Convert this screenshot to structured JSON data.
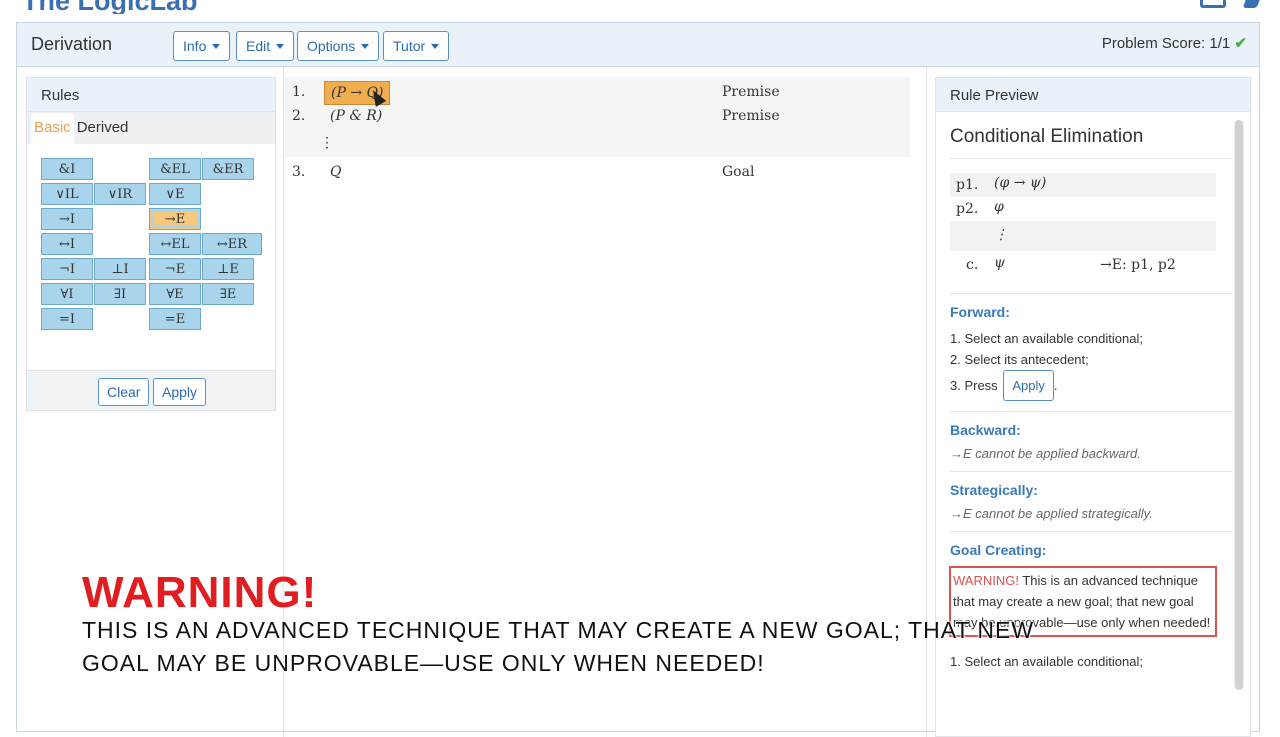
{
  "app": {
    "brand": "The LogicLab"
  },
  "header": {
    "title": "Derivation",
    "menus": [
      "Info",
      "Edit",
      "Options",
      "Tutor"
    ],
    "score_label": "Problem Score: 1/1",
    "score_check": "✔"
  },
  "rules_panel": {
    "title": "Rules",
    "tabs": [
      "Basic",
      "Derived"
    ],
    "buttons": [
      "&I",
      "&EL",
      "&ER",
      "∨IL",
      "∨IR",
      "∨E",
      "→I",
      "→E",
      "↔I",
      "↔EL",
      "↔ER",
      "¬I",
      "⊥I",
      "¬E",
      "⊥E",
      "∀I",
      "∃I",
      "∀E",
      "∃E",
      "=I",
      "=E"
    ],
    "selected": "→E",
    "clear_label": "Clear",
    "apply_label": "Apply"
  },
  "derivation": {
    "lines": [
      {
        "num": "1.",
        "formula": "(P → Q)",
        "just": "Premise",
        "highlighted": true
      },
      {
        "num": "2.",
        "formula": "(P & R)",
        "just": "Premise",
        "highlighted": false
      },
      {
        "num": "3.",
        "formula": "Q",
        "just": "Goal",
        "highlighted": false
      }
    ],
    "gap_dots": "⋮"
  },
  "rule_preview": {
    "title": "Rule Preview",
    "rule_name": "Conditional Elimination",
    "schema": [
      {
        "num": "p1.",
        "formula": "(φ → ψ)",
        "just": ""
      },
      {
        "num": "p2.",
        "formula": "φ",
        "just": ""
      },
      {
        "num": "",
        "formula": "⋮",
        "just": ""
      },
      {
        "num": "c.",
        "formula": "ψ",
        "just": "→E: p1, p2"
      }
    ],
    "forward": {
      "heading": "Forward:",
      "steps": [
        "1. Select an available conditional;",
        "2. Select its antecedent;",
        "3. Press"
      ],
      "apply_label": "Apply",
      "end": "."
    },
    "backward": {
      "heading": "Backward:",
      "text": "→E cannot be applied backward."
    },
    "strategically": {
      "heading": "Strategically:",
      "text": "→E cannot be applied strategically."
    },
    "goal_creating": {
      "heading": "Goal Creating:",
      "warning_word": "WARNING!",
      "warning_text": " This is an advanced technique that may create a new goal; that new goal may be unprovable—use only when needed!",
      "next_line": "1. Select an available conditional;"
    }
  },
  "overlay": {
    "title": "WARNING!",
    "line1": "THIS IS AN ADVANCED TECHNIQUE THAT MAY CREATE A NEW GOAL; THAT NEW",
    "line2": "GOAL MAY BE UNPROVABLE—USE ONLY WHEN NEEDED!"
  }
}
